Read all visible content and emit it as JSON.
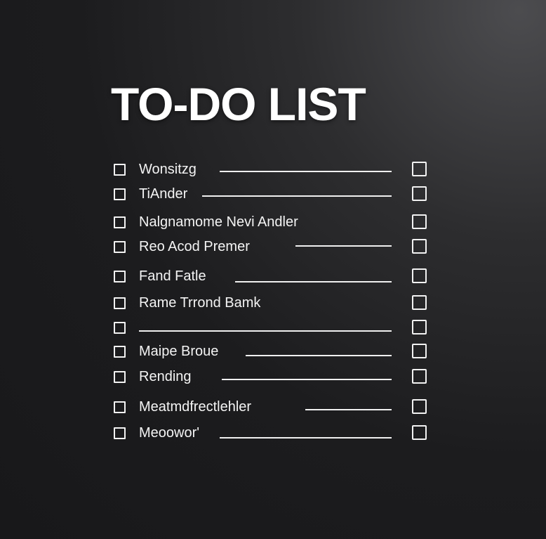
{
  "title": "TO-DO LIST",
  "items": [
    {
      "label": "Wonsitzg"
    },
    {
      "label": "TiAnder"
    },
    {
      "label": "Nalgnamome Nevi Andler"
    },
    {
      "label": "Reo Acod Premer"
    },
    {
      "label": "Fand Fatle"
    },
    {
      "label": "Rame Trrond Bamk"
    },
    {
      "label": ""
    },
    {
      "label": "Maipe Broue"
    },
    {
      "label": "Rending"
    },
    {
      "label": "Meatmdfrectlehler"
    },
    {
      "label": "Meoowor'"
    }
  ]
}
